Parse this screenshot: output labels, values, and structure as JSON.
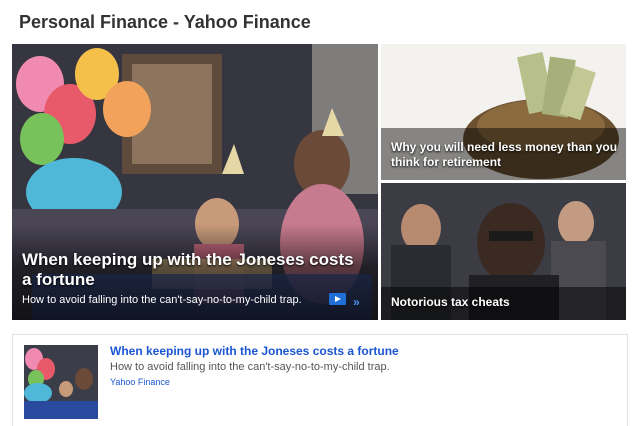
{
  "page": {
    "title": "Personal Finance - Yahoo Finance"
  },
  "hero": {
    "main": {
      "headline": "When keeping up with the Joneses costs a fortune",
      "summary": "How to avoid falling into the can't-say-no-to-my-child trap.",
      "video_icon": "play-icon",
      "more_icon": "double-chevron-right-icon",
      "more_label": "»"
    },
    "side": [
      {
        "headline": "Why you will need less money than you think for retirement"
      },
      {
        "headline": "Notorious tax cheats"
      }
    ]
  },
  "card": {
    "title": "When keeping up with the Joneses costs a fortune",
    "summary": "How to avoid falling into the can't-say-no-to-my-child trap.",
    "source": "Yahoo Finance"
  },
  "colors": {
    "link": "#1a56d3",
    "title_text": "#333333",
    "video_badge": "#1f6fd6"
  }
}
